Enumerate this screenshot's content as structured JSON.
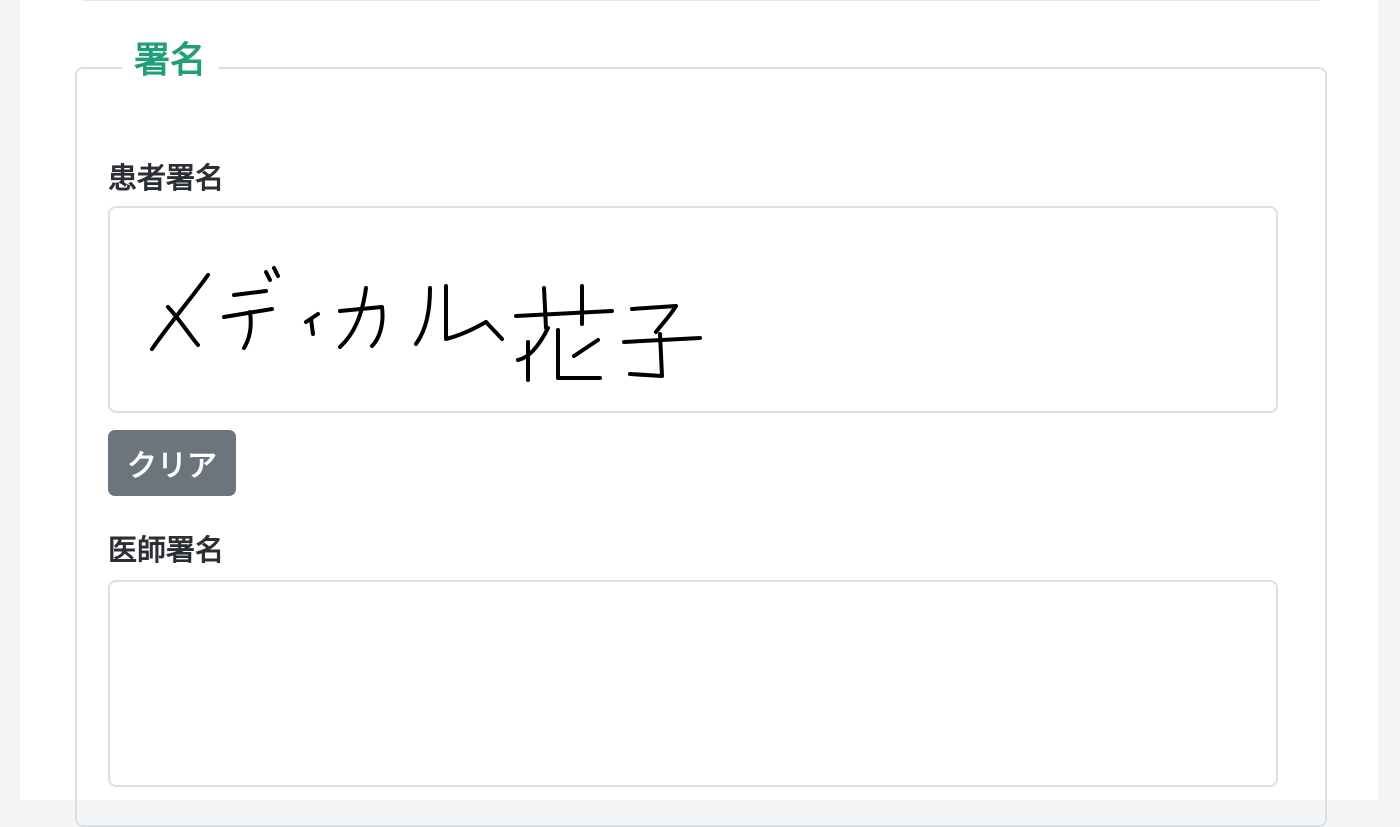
{
  "section": {
    "legend": "署名"
  },
  "patient_signature": {
    "label": "患者署名",
    "handwritten_content": "メディカル花子",
    "clear_label": "クリア"
  },
  "doctor_signature": {
    "label": "医師署名"
  },
  "colors": {
    "accent": "#1f9e78",
    "button_bg": "#6c757d",
    "border": "#dcdfe3"
  }
}
